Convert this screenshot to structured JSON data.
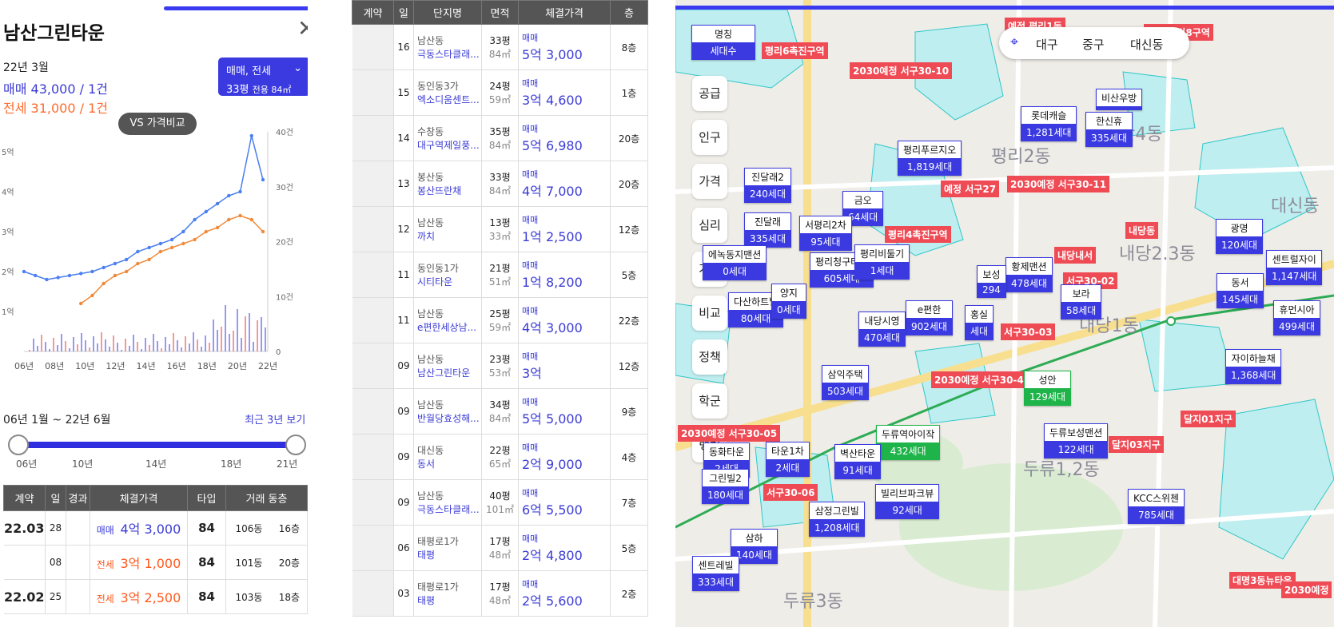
{
  "left": {
    "title": "남산그린타운",
    "close": "✕",
    "date": "22년 3월",
    "sale": "매매 43,000 / 1건",
    "rent": "전세 31,000 / 1건",
    "filter": {
      "type": "매매, 전세",
      "size": "33평",
      "exclusive": "전용 84㎡"
    },
    "vs": "VS 가격비교",
    "range": "06년 1월 ~ 22년 6월",
    "recent": "최근 3년 보기",
    "slider_ticks": [
      "06년",
      "10년",
      "14년",
      "18년",
      "21년"
    ],
    "table": {
      "headers": [
        "계약",
        "일",
        "경과",
        "체결가격",
        "타입",
        "거래 동층"
      ],
      "rows": [
        {
          "ym": "22.03",
          "d": "28",
          "kind": "매매",
          "price": "4억 3,000",
          "type": "84",
          "dong": "106동",
          "floor": "16층"
        },
        {
          "ym": "",
          "d": "08",
          "kind": "전세",
          "price": "3억 1,000",
          "type": "84",
          "dong": "101동",
          "floor": "20층"
        },
        {
          "ym": "22.02",
          "d": "25",
          "kind": "전세",
          "price": "3억 2,500",
          "type": "84",
          "dong": "103동",
          "floor": "18층"
        }
      ]
    }
  },
  "chart_data": {
    "type": "line",
    "x_ticks": [
      "06년",
      "08년",
      "10년",
      "12년",
      "14년",
      "16년",
      "18년",
      "20년",
      "22년"
    ],
    "y_left_ticks": [
      "5억",
      "4억",
      "3억",
      "2억",
      "1억"
    ],
    "y_right_ticks": [
      "40건",
      "30건",
      "20건",
      "10건",
      "0"
    ],
    "series": [
      {
        "name": "매매",
        "color": "#4a7ff0",
        "values": [
          2.0,
          1.9,
          1.8,
          1.85,
          1.9,
          1.95,
          2.0,
          2.1,
          2.2,
          2.3,
          2.5,
          2.6,
          2.7,
          2.8,
          3.0,
          3.3,
          3.5,
          3.7,
          3.9,
          4.0,
          5.4,
          4.3
        ]
      },
      {
        "name": "전세",
        "color": "#f08a3a",
        "values": [
          0,
          0,
          0,
          0,
          0,
          1.2,
          1.4,
          1.7,
          1.9,
          2.0,
          2.2,
          2.3,
          2.5,
          2.6,
          2.7,
          2.8,
          3.0,
          3.1,
          3.3,
          3.4,
          3.3,
          3.0
        ]
      }
    ],
    "y_left_range": [
      0,
      5.5
    ],
    "y_right_range": [
      0,
      40
    ]
  },
  "mid": {
    "headers": [
      "계약",
      "일",
      "단지명",
      "면적",
      "체결가격",
      "층"
    ],
    "rows": [
      {
        "d": "16",
        "dong": "남산동",
        "name": "극동스타클래...",
        "p": "33평",
        "m": "84㎡",
        "t": "매매",
        "v": "5억 3,000",
        "f": "8층"
      },
      {
        "d": "15",
        "dong": "동인동3가",
        "name": "엑소디움센트...",
        "p": "24평",
        "m": "59㎡",
        "t": "매매",
        "v": "3억 4,600",
        "f": "1층"
      },
      {
        "d": "14",
        "dong": "수창동",
        "name": "대구역제일풍...",
        "p": "35평",
        "m": "84㎡",
        "t": "매매",
        "v": "5억 6,980",
        "f": "20층"
      },
      {
        "d": "13",
        "dong": "봉산동",
        "name": "봉산뜨란채",
        "p": "33평",
        "m": "84㎡",
        "t": "매매",
        "v": "4억 7,000",
        "f": "20층"
      },
      {
        "d": "12",
        "dong": "남산동",
        "name": "까치",
        "p": "13평",
        "m": "33㎡",
        "t": "매매",
        "v": "1억 2,500",
        "f": "12층"
      },
      {
        "d": "11",
        "dong": "동인동1가",
        "name": "시티타운",
        "p": "21평",
        "m": "51㎡",
        "t": "매매",
        "v": "1억 8,200",
        "f": "5층"
      },
      {
        "d": "11",
        "dong": "남산동",
        "name": "e편한세상남...",
        "p": "25평",
        "m": "59㎡",
        "t": "매매",
        "v": "4억 3,000",
        "f": "22층"
      },
      {
        "d": "09",
        "dong": "남산동",
        "name": "남산그린타운",
        "p": "23평",
        "m": "53㎡",
        "t": "매매",
        "v": "3억",
        "f": "12층"
      },
      {
        "d": "09",
        "dong": "남산동",
        "name": "반월당효성해...",
        "p": "34평",
        "m": "84㎡",
        "t": "매매",
        "v": "5억 5,000",
        "f": "9층"
      },
      {
        "d": "09",
        "dong": "대신동",
        "name": "동서",
        "p": "22평",
        "m": "65㎡",
        "t": "매매",
        "v": "2억 9,000",
        "f": "4층"
      },
      {
        "d": "09",
        "dong": "남산동",
        "name": "극동스타클래...",
        "p": "40평",
        "m": "101㎡",
        "t": "매매",
        "v": "6억 5,500",
        "f": "7층"
      },
      {
        "d": "06",
        "dong": "태평로1가",
        "name": "태평",
        "p": "17평",
        "m": "48㎡",
        "t": "매매",
        "v": "2억 4,800",
        "f": "5층"
      },
      {
        "d": "03",
        "dong": "태평로1가",
        "name": "태평",
        "p": "17평",
        "m": "48㎡",
        "t": "매매",
        "v": "2억 5,600",
        "f": "2층"
      }
    ]
  },
  "map": {
    "loc": [
      "대구",
      "중구",
      "대신동"
    ],
    "legend": {
      "name": "명칭",
      "count": "세대수"
    },
    "side": [
      "공급",
      "인구",
      "가격",
      "심리",
      "거래",
      "비교",
      "정책",
      "학군",
      "랭킹"
    ],
    "places": [
      "평리2동",
      "내당2.3동",
      "두류1,2동",
      "두류3동",
      "대신동",
      "산4동",
      "내당1동"
    ],
    "tags": [
      {
        "n": "롯데캐슬",
        "c": "1,281세대"
      },
      {
        "n": "비산우방",
        "c": ""
      },
      {
        "n": "한신휴",
        "c": "335세대"
      },
      {
        "n": "평리푸르지오",
        "c": "1,819세대"
      },
      {
        "n": "진달래2",
        "c": "240세대"
      },
      {
        "n": "금오",
        "c": "64세대"
      },
      {
        "n": "진달래",
        "c": "335세대"
      },
      {
        "n": "광명",
        "c": "120세대"
      },
      {
        "n": "센트럴자이",
        "c": "1,147세대"
      },
      {
        "n": "황제맨션",
        "c": "478세대"
      },
      {
        "n": "동서",
        "c": "145세대"
      },
      {
        "n": "보라",
        "c": "58세대"
      },
      {
        "n": "평리청구타운",
        "c": "605세대"
      },
      {
        "n": "다산하트빌",
        "c": "80세대"
      },
      {
        "n": "e편한",
        "c": "902세대"
      },
      {
        "n": "내당시영",
        "c": "470세대"
      },
      {
        "n": "휴먼시아",
        "c": "499세대"
      },
      {
        "n": "자이하늘채",
        "c": "1,368세대"
      },
      {
        "n": "삼익주택",
        "c": "503세대"
      },
      {
        "n": "성안",
        "c": "129세대"
      },
      {
        "n": "두류역아이작",
        "c": "432세대"
      },
      {
        "n": "두류보성맨션",
        "c": "122세대"
      },
      {
        "n": "벽산타운",
        "c": "91세대"
      },
      {
        "n": "빌리브파크뷰",
        "c": "92세대"
      },
      {
        "n": "KCC스위첸",
        "c": "785세대"
      },
      {
        "n": "삼정그린빌",
        "c": "1,208세대"
      },
      {
        "n": "삼하",
        "c": "140세대"
      },
      {
        "n": "센트레빌",
        "c": "333세대"
      },
      {
        "n": "동화타운",
        "c": "2세대"
      },
      {
        "n": "타운1차",
        "c": "2세대"
      },
      {
        "n": "서평리2차",
        "c": "95세대"
      },
      {
        "n": "평리비둘기",
        "c": "1세대"
      },
      {
        "n": "양지",
        "c": "0세대"
      },
      {
        "n": "홍실",
        "c": "세대"
      },
      {
        "n": "보성",
        "c": "294"
      },
      {
        "n": "그린빌2",
        "c": "180세대"
      },
      {
        "n": "에녹동지맨션",
        "c": "0세대"
      }
    ],
    "reds": [
      "예정 평리1동",
      "평리6촉진구역",
      "2030예정 서구30-10",
      "예정 서검8구역",
      "예정 서구27",
      "2030예정 서구30-11",
      "내당동",
      "달지01지구",
      "달지03지구",
      "대명3동뉴타운",
      "2030예정",
      "2030예정 서구30-05",
      "서구30-06",
      "2030예정 서구30-4",
      "서구30-03",
      "서구30-02",
      "내당내서",
      "평리4촉진구역"
    ]
  }
}
